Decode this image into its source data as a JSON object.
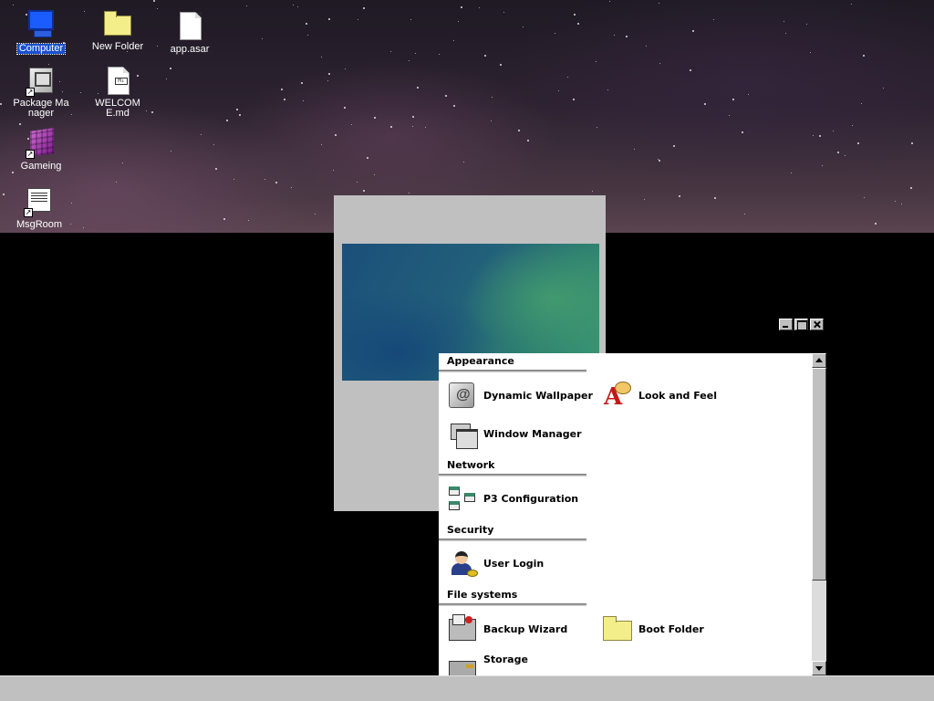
{
  "desktop": {
    "icons": [
      {
        "label": "Computer",
        "icon": "computer-icon",
        "selected": true
      },
      {
        "label": "New Folder",
        "icon": "folder-icon"
      },
      {
        "label": "app.asar",
        "icon": "file-icon"
      },
      {
        "label": "Package Manager",
        "icon": "package-manager-icon"
      },
      {
        "label": "WELCOME.md",
        "icon": "markdown-file-icon",
        "badge": "M↓"
      },
      {
        "label": "Gameing",
        "icon": "game-cube-icon"
      },
      {
        "label": "MsgRoom",
        "icon": "message-room-icon"
      }
    ]
  },
  "control_panel": {
    "sections": [
      {
        "title": "Appearance",
        "items": [
          {
            "label": "Dynamic Wallpaper",
            "icon": "wallpaper-icon"
          },
          {
            "label": "Look and Feel",
            "icon": "look-and-feel-icon"
          },
          {
            "label": "Window Manager",
            "icon": "window-manager-icon"
          }
        ]
      },
      {
        "title": "Network",
        "items": [
          {
            "label": "P3 Configuration",
            "icon": "network-config-icon"
          }
        ]
      },
      {
        "title": "Security",
        "items": [
          {
            "label": "User Login",
            "icon": "user-login-icon"
          }
        ]
      },
      {
        "title": "File systems",
        "items": [
          {
            "label": "Backup Wizard",
            "icon": "backup-wizard-icon"
          },
          {
            "label": "Boot Folder",
            "icon": "folder-icon"
          },
          {
            "label": "Storage",
            "icon": "storage-icon"
          }
        ]
      }
    ]
  },
  "colors": {
    "selection": "#1a4fd0",
    "window_face": "#c0c0c0",
    "folder_yellow": "#f4ee8a"
  }
}
